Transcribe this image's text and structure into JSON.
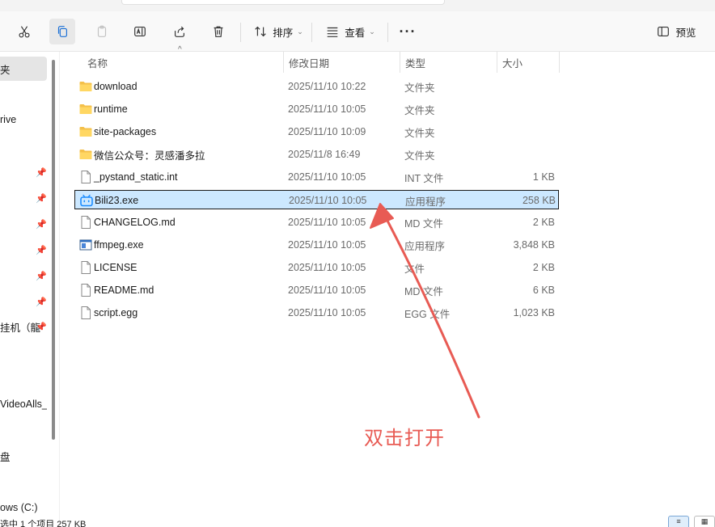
{
  "toolbar": {
    "sort_label": "排序",
    "view_label": "查看",
    "preview_label": "预览"
  },
  "sidebar": {
    "items": [
      {
        "label": "夹",
        "pinned": false
      },
      {
        "label": "rive",
        "pinned": false
      },
      {
        "label": "",
        "pinned": true
      },
      {
        "label": "",
        "pinned": true
      },
      {
        "label": "",
        "pinned": true
      },
      {
        "label": "",
        "pinned": true
      },
      {
        "label": "",
        "pinned": true
      },
      {
        "label": "",
        "pinned": true
      },
      {
        "label": "挂机（龍",
        "pinned": true
      },
      {
        "label": "VideoAlls_",
        "pinned": false
      },
      {
        "label": "盘",
        "pinned": false
      },
      {
        "label": "ows (C:)",
        "pinned": false
      }
    ]
  },
  "columns": {
    "name": "名称",
    "date": "修改日期",
    "type": "类型",
    "size": "大小"
  },
  "files": [
    {
      "name": "download",
      "date": "2025/11/10 10:22",
      "type": "文件夹",
      "size": "",
      "icon": "folder-icon"
    },
    {
      "name": "runtime",
      "date": "2025/11/10 10:05",
      "type": "文件夹",
      "size": "",
      "icon": "folder-icon"
    },
    {
      "name": "site-packages",
      "date": "2025/11/10 10:09",
      "type": "文件夹",
      "size": "",
      "icon": "folder-icon"
    },
    {
      "name": "微信公众号：灵感潘多拉",
      "date": "2025/11/8 16:49",
      "type": "文件夹",
      "size": "",
      "icon": "folder-icon"
    },
    {
      "name": "_pystand_static.int",
      "date": "2025/11/10 10:05",
      "type": "INT 文件",
      "size": "1 KB",
      "icon": "file-icon"
    },
    {
      "name": "Bili23.exe",
      "date": "2025/11/10 10:05",
      "type": "应用程序",
      "size": "258 KB",
      "icon": "bili-app-icon",
      "selected": true
    },
    {
      "name": "CHANGELOG.md",
      "date": "2025/11/10 10:05",
      "type": "MD 文件",
      "size": "2 KB",
      "icon": "file-icon"
    },
    {
      "name": "ffmpeg.exe",
      "date": "2025/11/10 10:05",
      "type": "应用程序",
      "size": "3,848 KB",
      "icon": "exe-icon"
    },
    {
      "name": "LICENSE",
      "date": "2025/11/10 10:05",
      "type": "文件",
      "size": "2 KB",
      "icon": "file-icon"
    },
    {
      "name": "README.md",
      "date": "2025/11/10 10:05",
      "type": "MD 文件",
      "size": "6 KB",
      "icon": "file-icon"
    },
    {
      "name": "script.egg",
      "date": "2025/11/10 10:05",
      "type": "EGG 文件",
      "size": "1,023 KB",
      "icon": "file-icon"
    }
  ],
  "annotation": {
    "text": "双击打开",
    "color": "#e85b54"
  },
  "status": {
    "text": "选中 1 个项目  257 KB"
  },
  "colors": {
    "selection": "#cce8ff",
    "folder": "#f4c04a",
    "accent": "#1a8cff"
  }
}
